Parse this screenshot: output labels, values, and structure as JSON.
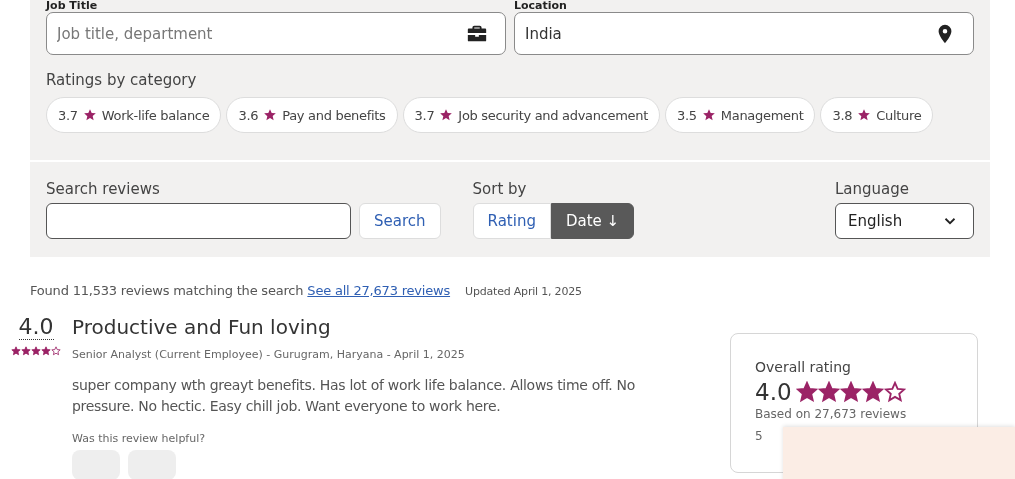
{
  "filters": {
    "job_title": {
      "label": "Job Title",
      "placeholder": "Job title, department"
    },
    "location": {
      "label": "Location",
      "value": "India"
    }
  },
  "ratings_by_category": {
    "title": "Ratings by category",
    "items": [
      {
        "score": "3.7",
        "label": "Work-life balance"
      },
      {
        "score": "3.6",
        "label": "Pay and benefits"
      },
      {
        "score": "3.7",
        "label": "Job security and advancement"
      },
      {
        "score": "3.5",
        "label": "Management"
      },
      {
        "score": "3.8",
        "label": "Culture"
      }
    ]
  },
  "search": {
    "label": "Search reviews",
    "button": "Search"
  },
  "sort": {
    "label": "Sort by",
    "options": [
      {
        "label": "Rating",
        "selected": false
      },
      {
        "label": "Date ↓",
        "selected": true
      }
    ]
  },
  "language": {
    "label": "Language",
    "value": "English"
  },
  "results": {
    "found": "Found 11,533 reviews matching the search",
    "link": "See all 27,673 reviews",
    "updated": "Updated April 1, 2025"
  },
  "review": {
    "rating": "4.0",
    "stars": 4,
    "title": "Productive and Fun loving",
    "meta": "Senior Analyst (Current Employee) - Gurugram, Haryana - April 1, 2025",
    "body": "super company wth greayt benefits. Has lot of work life balance. Allows time off. No pressure. No hectic. Easy chill job. Want everyone to work here.",
    "helpful": "Was this review helpful?"
  },
  "overall": {
    "title": "Overall rating",
    "rating": "4.0",
    "stars": 4,
    "based_on": "Based on 27,673 reviews",
    "first_row": "5"
  }
}
